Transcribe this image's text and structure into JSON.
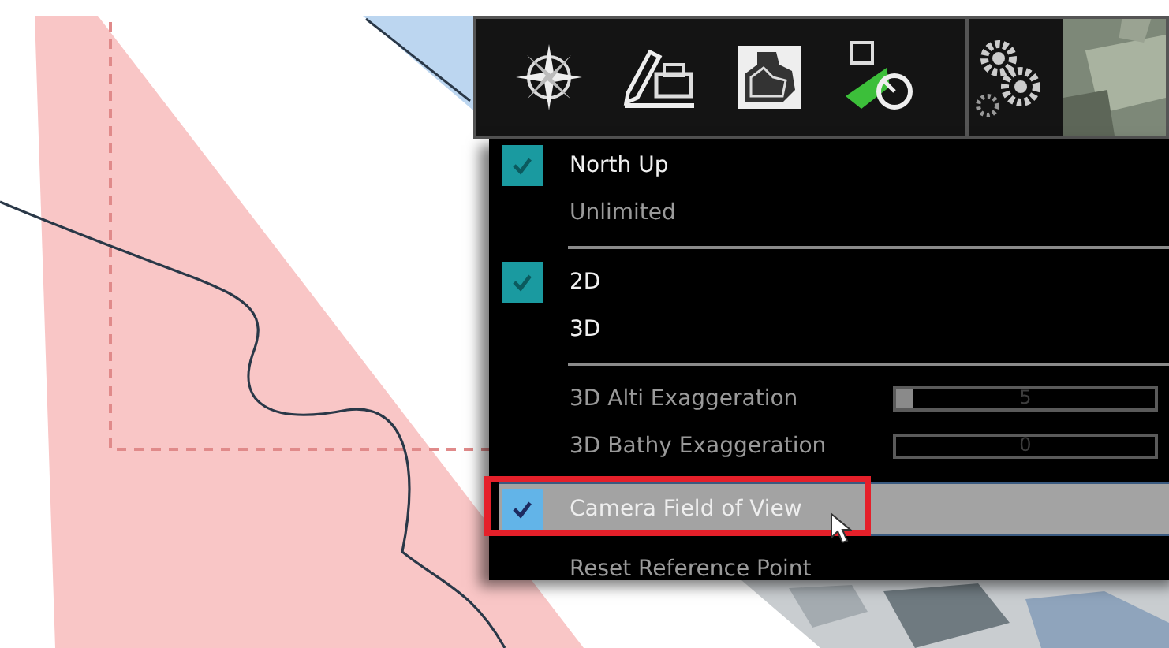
{
  "menu": {
    "items": [
      {
        "kind": "check",
        "label": "North Up",
        "checked": true,
        "disabled": false,
        "selected": false,
        "callout": false
      },
      {
        "kind": "check",
        "label": "Unlimited",
        "checked": false,
        "disabled": true,
        "selected": false,
        "callout": false
      },
      {
        "kind": "separator"
      },
      {
        "kind": "check",
        "label": "2D",
        "checked": true,
        "disabled": false,
        "selected": false,
        "callout": false
      },
      {
        "kind": "check",
        "label": "3D",
        "checked": false,
        "disabled": false,
        "selected": false,
        "callout": false
      },
      {
        "kind": "separator"
      },
      {
        "kind": "slider",
        "label": "3D Alti Exaggeration",
        "value": "5",
        "level": 0.07
      },
      {
        "kind": "slider",
        "label": "3D Bathy Exaggeration",
        "value": "0",
        "level": 0
      },
      {
        "kind": "check",
        "label": "Camera Field of View",
        "checked": true,
        "disabled": true,
        "selected": true,
        "callout": true
      },
      {
        "kind": "action",
        "label": "Reset Reference Point"
      }
    ]
  }
}
